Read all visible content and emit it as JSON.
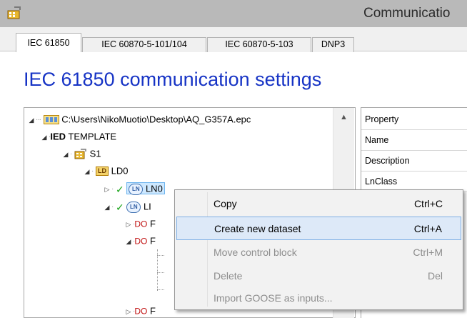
{
  "window": {
    "title": "Communicatio",
    "colors": {
      "titlebar": "#b9b9b9",
      "accent": "#1633c5"
    }
  },
  "tabs": [
    {
      "label": "IEC 61850",
      "active": true
    },
    {
      "label": "IEC 60870-5-101/104",
      "active": false
    },
    {
      "label": "IEC 60870-5-103",
      "active": false
    },
    {
      "label": "DNP3",
      "active": false
    }
  ],
  "page_title": "IEC 61850 communication settings",
  "tree": {
    "root_path": "C:\\Users\\NikoMuotio\\Desktop\\AQ_G357A.epc",
    "ied": "IED TEMPLATE",
    "ied_prefix": "IED",
    "ied_name": " TEMPLATE",
    "server": "S1",
    "ld_tag": "LD",
    "ld_name": "LD0",
    "ln_tag": "LN",
    "ln0_label": "LN0",
    "ln1_label": "LI",
    "do_prefix": "DO",
    "do_labels": [
      "F",
      "F",
      "F"
    ]
  },
  "properties": {
    "rows": [
      "Property",
      "Name",
      "Description",
      "LnClass"
    ]
  },
  "context_menu": {
    "items": [
      {
        "label": "Copy",
        "shortcut": "Ctrl+C",
        "enabled": true,
        "hover": false
      },
      {
        "label": "Create new dataset",
        "shortcut": "Ctrl+A",
        "enabled": true,
        "hover": true
      },
      {
        "label": "Move control block",
        "shortcut": "Ctrl+M",
        "enabled": false,
        "hover": false
      },
      {
        "label": "Delete",
        "shortcut": "Del",
        "enabled": false,
        "hover": false
      },
      {
        "label": "Import GOOSE as inputs...",
        "shortcut": "",
        "enabled": false,
        "hover": false
      }
    ]
  }
}
